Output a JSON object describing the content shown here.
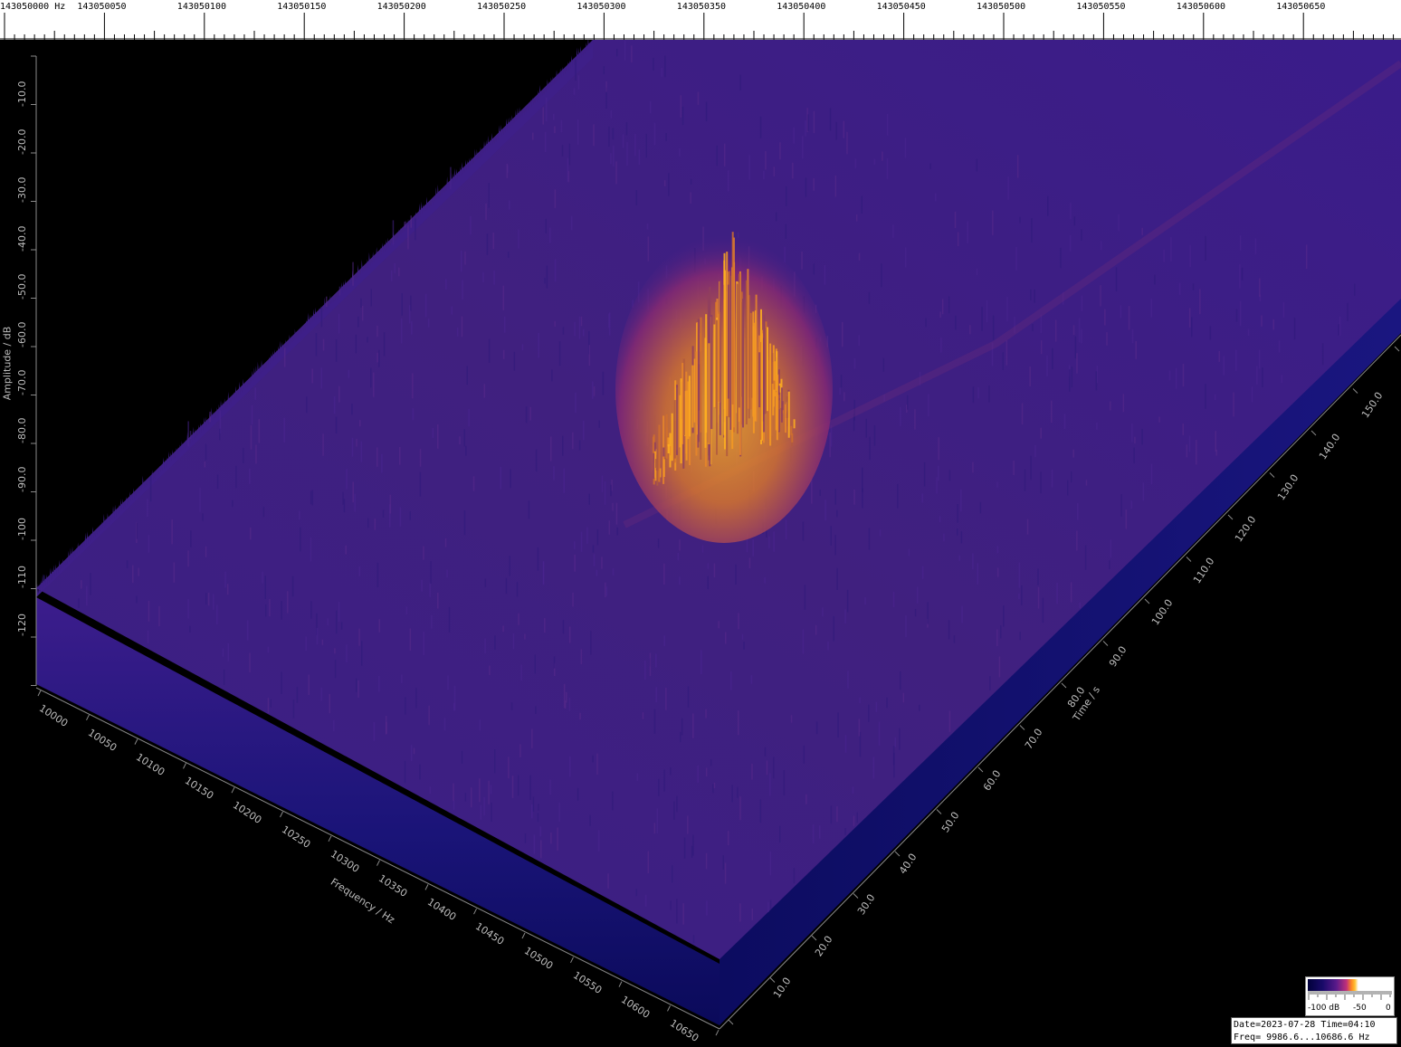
{
  "top_ruler": {
    "labels": [
      "143050000 Hz",
      "143050050",
      "143050100",
      "143050150",
      "143050200",
      "143050250",
      "143050300",
      "143050350",
      "143050400",
      "143050450",
      "143050500",
      "143050550",
      "143050600",
      "143050650"
    ]
  },
  "amplitude_axis": {
    "title": "Amplitude / dB",
    "ticks": [
      "-10.0",
      "-20.0",
      "-30.0",
      "-40.0",
      "-50.0",
      "-60.0",
      "-70.0",
      "-80.0",
      "-90.0",
      "-100",
      "-110",
      "-120"
    ]
  },
  "frequency_axis": {
    "title": "Frequency / Hz",
    "ticks": [
      "10000",
      "10050",
      "10100",
      "10150",
      "10200",
      "10250",
      "10300",
      "10350",
      "10400",
      "10450",
      "10500",
      "10550",
      "10600",
      "10650"
    ]
  },
  "time_axis": {
    "title": "Time / s",
    "ticks": [
      "10.0",
      "20.0",
      "30.0",
      "40.0",
      "50.0",
      "60.0",
      "70.0",
      "80.0",
      "90.0",
      "100.0",
      "110.0",
      "120.0",
      "130.0",
      "140.0",
      "150.0"
    ]
  },
  "legend": {
    "labels": [
      "-100 dB",
      "-50",
      "0"
    ]
  },
  "info": {
    "line1": "Date=2023-07-28 Time=04:10",
    "line2": "Freq= 9986.6...10686.6 Hz"
  },
  "colors": {
    "background": "#000000",
    "noise_floor": "#3a1a8a",
    "base_edge": "#10106a",
    "peak": "#ffb020"
  }
}
